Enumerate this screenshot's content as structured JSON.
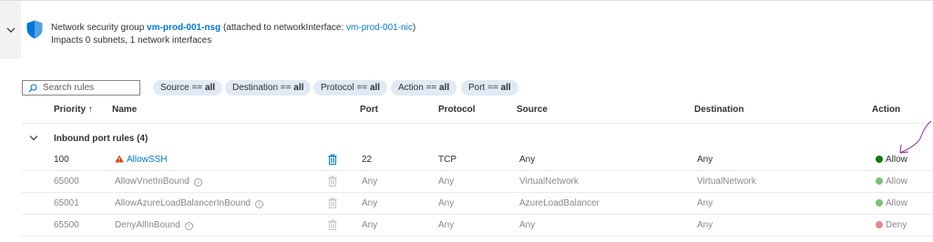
{
  "nsg": {
    "title_prefix": "Network security group",
    "name": "vm-prod-001-nsg",
    "attached_prefix": "(attached to networkInterface:",
    "nic": "vm-prod-001-nic",
    "attached_suffix": ")",
    "impact": "Impacts 0 subnets, 1 network interfaces"
  },
  "search": {
    "placeholder": "Search rules"
  },
  "filters": [
    {
      "label": "Source ==",
      "value": "all"
    },
    {
      "label": "Destination ==",
      "value": "all"
    },
    {
      "label": "Protocol ==",
      "value": "all"
    },
    {
      "label": "Action ==",
      "value": "all"
    },
    {
      "label": "Port ==",
      "value": "all"
    }
  ],
  "columns": {
    "priority": "Priority ↑",
    "name": "Name",
    "port": "Port",
    "protocol": "Protocol",
    "source": "Source",
    "destination": "Destination",
    "action": "Action"
  },
  "group": {
    "label": "Inbound port rules (4)"
  },
  "rules": [
    {
      "priority": "100",
      "name": "AllowSSH",
      "port": "22",
      "protocol": "TCP",
      "source": "Any",
      "destination": "Any",
      "action": "Allow"
    },
    {
      "priority": "65000",
      "name": "AllowVnetInBound",
      "port": "Any",
      "protocol": "Any",
      "source": "VirtualNetwork",
      "destination": "VirtualNetwork",
      "action": "Allow"
    },
    {
      "priority": "65001",
      "name": "AllowAzureLoadBalancerInBound",
      "port": "Any",
      "protocol": "Any",
      "source": "AzureLoadBalancer",
      "destination": "Any",
      "action": "Allow"
    },
    {
      "priority": "65500",
      "name": "DenyAllInBound",
      "port": "Any",
      "protocol": "Any",
      "source": "Any",
      "destination": "Any",
      "action": "Deny"
    }
  ],
  "colors": {
    "accent": "#0078d4",
    "allow": "#107c10",
    "deny": "#d13438",
    "warning": "#d83b01",
    "annotation": "#8b2c9b"
  }
}
